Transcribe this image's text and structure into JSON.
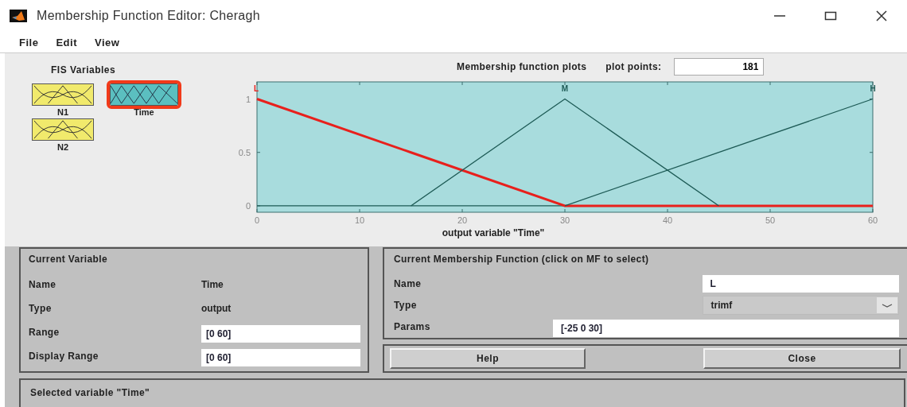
{
  "window": {
    "title": "Membership Function Editor: Cheragh"
  },
  "menu": [
    "File",
    "Edit",
    "View"
  ],
  "fis_variables": {
    "title": "FIS Variables",
    "items": [
      {
        "label": "N1",
        "kind": "input",
        "selected": false
      },
      {
        "label": "Time",
        "kind": "output",
        "selected": true
      },
      {
        "label": "N2",
        "kind": "input",
        "selected": false
      }
    ]
  },
  "plot": {
    "plot_points_label": "plot points:",
    "plot_points": "181",
    "chart_data": {
      "type": "line",
      "title": "Membership function plots",
      "xlabel": "output variable \"Time\"",
      "x": [
        0,
        15,
        30,
        45,
        60
      ],
      "series": [
        {
          "name": "L",
          "color": "#e8201c",
          "values": [
            1,
            0.5,
            0,
            0,
            0
          ]
        },
        {
          "name": "M",
          "color": "#1d5a55",
          "values": [
            null,
            0,
            1,
            0,
            null
          ]
        },
        {
          "name": "H",
          "color": "#1d5a55",
          "values": [
            null,
            null,
            0,
            0.5,
            1
          ]
        }
      ],
      "xlim": [
        0,
        60
      ],
      "ylim": [
        -0.06,
        1.16
      ],
      "xticks": [
        0,
        10,
        20,
        30,
        40,
        50,
        60
      ],
      "yticks": [
        0,
        0.5,
        1
      ]
    }
  },
  "current_variable": {
    "title": "Current Variable",
    "fields": [
      {
        "label": "Name",
        "value": "Time",
        "kind": "text"
      },
      {
        "label": "Type",
        "value": "output",
        "kind": "text"
      },
      {
        "label": "Range",
        "value": "[0 60]",
        "kind": "input"
      },
      {
        "label": "Display Range",
        "value": "[0 60]",
        "kind": "input"
      }
    ]
  },
  "current_mf": {
    "title": "Current Membership Function (click on MF to select)",
    "name": {
      "label": "Name",
      "value": "L"
    },
    "type": {
      "label": "Type",
      "value": "trimf"
    },
    "params": {
      "label": "Params",
      "value": "[-25 0 30]"
    }
  },
  "buttons": [
    "Help",
    "Close"
  ],
  "status": "Selected variable \"Time\""
}
